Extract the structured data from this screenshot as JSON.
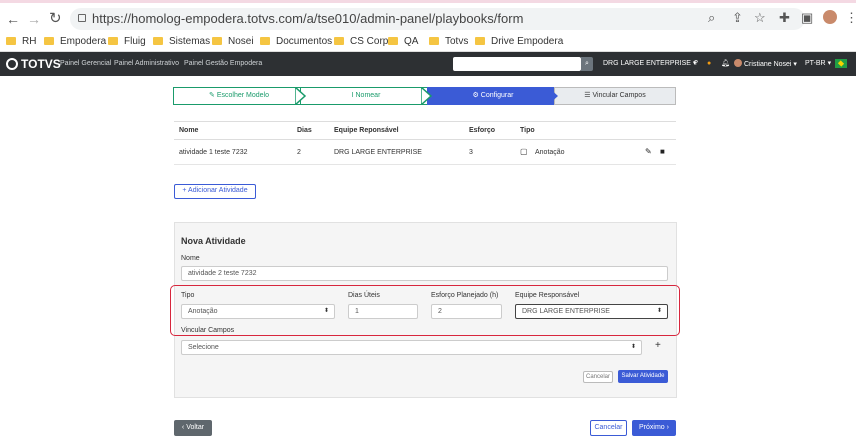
{
  "browser": {
    "url": "https://homolog-empodera.totvs.com/a/tse010/admin-panel/playbooks/form",
    "nav_back": "←",
    "nav_forward": "→",
    "nav_reload": "↻",
    "bookmarks": [
      "RH",
      "Empodera",
      "Fluig",
      "Sistemas",
      "Nosei",
      "Documentos",
      "CS Corp",
      "QA",
      "Totvs",
      "Drive Empodera"
    ]
  },
  "appnav": {
    "logo": "TOTVS",
    "links": [
      "Painel Gerencial",
      "Painel Administrativo",
      "Painel Gestão Empodera"
    ],
    "company": "DRG LARGE ENTERPRISE",
    "user": "Cristiane Nosei",
    "language": "PT-BR"
  },
  "stepper": {
    "steps": [
      {
        "label": "Escolher Modelo",
        "state": "done"
      },
      {
        "label": "Nomear",
        "state": "done"
      },
      {
        "label": "Configurar",
        "state": "active"
      },
      {
        "label": "Vincular Campos",
        "state": "todo"
      }
    ]
  },
  "table": {
    "headers": [
      "Nome",
      "Dias",
      "Equipe Reponsável",
      "Esforço",
      "Tipo"
    ],
    "rows": [
      {
        "nome": "atividade 1 teste 7232",
        "dias": "2",
        "equipe": "DRG LARGE ENTERPRISE",
        "esforco": "3",
        "tipo": "Anotação"
      }
    ]
  },
  "add_button": "Adicionar Atividade",
  "form": {
    "title": "Nova Atividade",
    "nome_label": "Nome",
    "nome_value": "atividade 2 teste 7232",
    "tipo_label": "Tipo",
    "tipo_value": "Anotação",
    "dias_label": "Dias Úteis",
    "dias_value": "1",
    "esforco_label": "Esforço Planejado (h)",
    "esforco_value": "2",
    "equipe_label": "Equipe Responsável",
    "equipe_value": "DRG LARGE ENTERPRISE",
    "vincular_label": "Vincular Campos",
    "vincular_value": "Selecione",
    "cancel": "Cancelar",
    "save": "Salvar Atividade"
  },
  "footer": {
    "back": "Voltar",
    "cancel": "Cancelar",
    "next": "Próximo"
  },
  "colors": {
    "accent": "#3b5bd6",
    "done_step": "#1a9b6b",
    "highlight": "#d7263d"
  }
}
